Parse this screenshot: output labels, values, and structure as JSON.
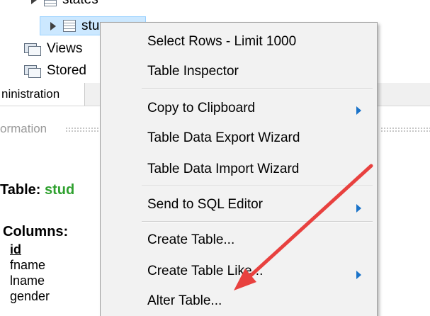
{
  "navigator": {
    "states_label": "states",
    "students_label": "stu",
    "views_label": "Views",
    "stored_label": "Stored"
  },
  "tabs": {
    "administration_label": "ninistration"
  },
  "info": {
    "header_label": "ormation",
    "table_prefix": "Table: ",
    "table_name": "stud",
    "columns_label": "Columns:",
    "columns": [
      "id",
      "fname",
      "lname",
      "gender"
    ]
  },
  "context_menu": {
    "items": [
      "Select Rows - Limit 1000",
      "Table Inspector",
      "Copy to Clipboard",
      "Table Data Export Wizard",
      "Table Data Import Wizard",
      "Send to SQL Editor",
      "Create Table...",
      "Create Table Like...",
      "Alter Table..."
    ]
  },
  "colors": {
    "annotation_arrow": "#e8413f",
    "table_name": "#2fa12f",
    "submenu_arrow": "#1a73c9"
  }
}
